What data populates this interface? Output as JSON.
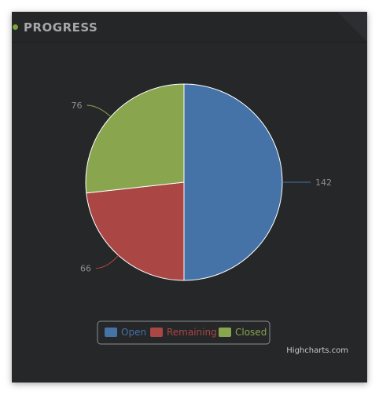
{
  "header": {
    "title": "PROGRESS"
  },
  "chart_data": {
    "type": "pie",
    "title": "",
    "slices": [
      {
        "name": "Open",
        "value": 142,
        "color": "#4572a7"
      },
      {
        "name": "Remaining",
        "value": 66,
        "color": "#aa4643"
      },
      {
        "name": "Closed",
        "value": 76,
        "color": "#89a54e"
      }
    ],
    "legend": {
      "placement": "bottom-center",
      "items": [
        "Open",
        "Remaining",
        "Closed"
      ]
    },
    "data_labels": [
      "142",
      "66",
      "76"
    ]
  },
  "credits": "Highcharts.com",
  "colors": {
    "panel_background": "#262729",
    "title_text": "#a5a7aa",
    "accent_dot": "#7aa33a",
    "label_text": "#8a8d90"
  }
}
